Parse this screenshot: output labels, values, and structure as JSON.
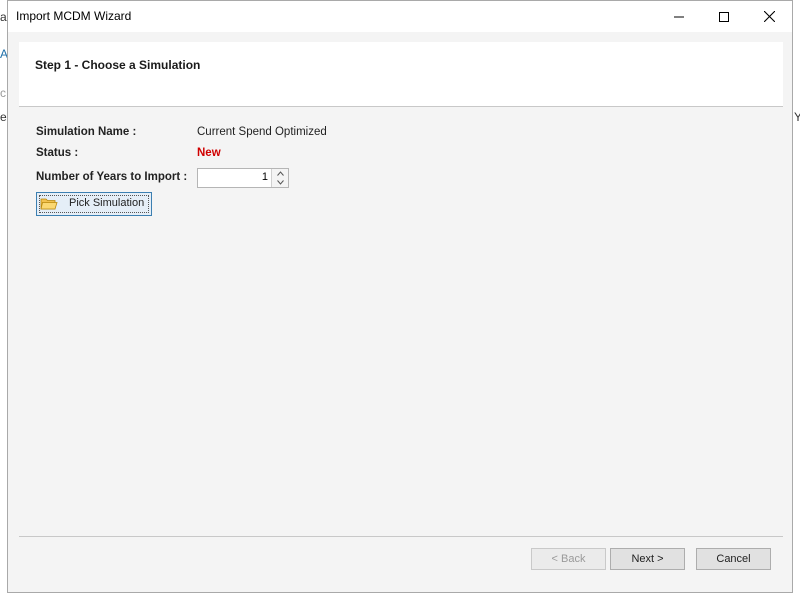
{
  "window": {
    "title": "Import MCDM Wizard"
  },
  "background_fragments": {
    "frag1": "a",
    "frag2": "Ar",
    "frag3": "c",
    "frag4": "e",
    "frag5": "Y"
  },
  "wizard": {
    "step_title": "Step 1 - Choose a Simulation",
    "fields": {
      "simulation_name_label": "Simulation Name :",
      "simulation_name_value": "Current Spend Optimized",
      "status_label": "Status :",
      "status_value": "New",
      "years_label": "Number of Years to Import :",
      "years_value": "1"
    },
    "pick_button_label": "Pick Simulation"
  },
  "footer": {
    "back_label": "< Back",
    "next_label": "Next >",
    "cancel_label": "Cancel"
  },
  "colors": {
    "status_new": "#d00000",
    "accent": "#3c7fb1"
  },
  "icons": {
    "pick": "folder-icon",
    "minimize": "minimize-icon",
    "maximize": "maximize-icon",
    "close": "close-icon"
  }
}
